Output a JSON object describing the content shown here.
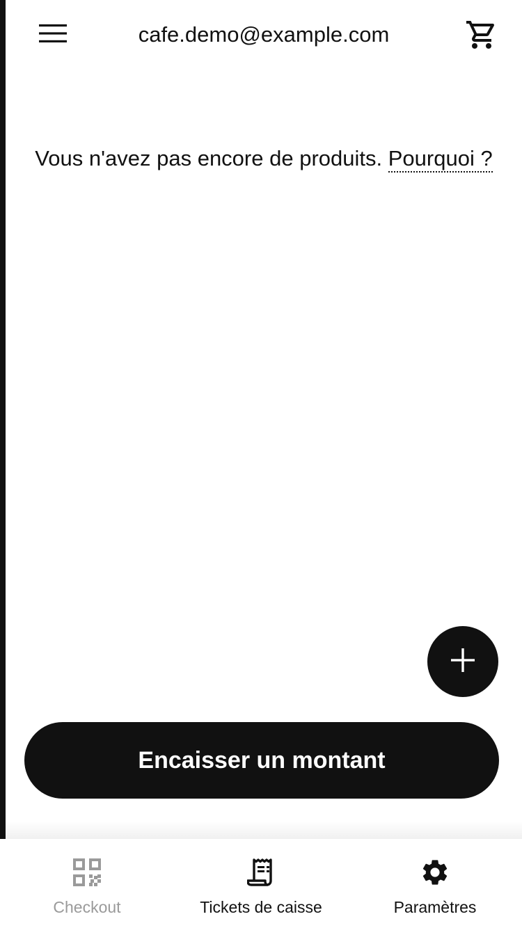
{
  "header": {
    "title": "cafe.demo@example.com",
    "menu_icon": "hamburger-menu-icon",
    "cart_icon": "shopping-cart-icon"
  },
  "main": {
    "empty_message": "Vous n'avez pas encore de produits.",
    "why_link": "Pourquoi ?"
  },
  "fab": {
    "icon": "plus-icon"
  },
  "charge_button": {
    "label": "Encaisser un montant"
  },
  "tabbar": {
    "items": [
      {
        "label": "Checkout",
        "icon": "qr-code-icon",
        "active": false
      },
      {
        "label": "Tickets de caisse",
        "icon": "receipt-icon",
        "active": true
      },
      {
        "label": "Paramètres",
        "icon": "gear-icon",
        "active": true
      }
    ]
  },
  "colors": {
    "primary": "#111111",
    "background": "#ffffff",
    "inactive": "#9a9a9a"
  }
}
